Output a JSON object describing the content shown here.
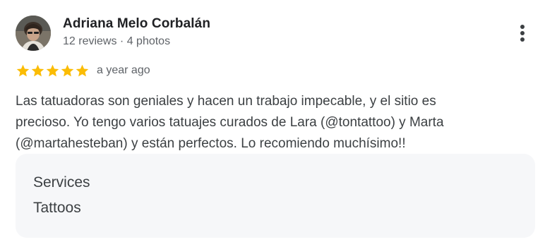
{
  "review": {
    "author": {
      "name": "Adriana Melo Corbalán",
      "meta": "12 reviews · 4 photos"
    },
    "rating": {
      "stars": 5,
      "max_stars": 5,
      "star_color": "#fbbc04"
    },
    "date": "a year ago",
    "text_lines": [
      "Las tatuadoras son geniales y hacen un trabajo impecable, y el sitio es",
      "precioso. Yo tengo varios tatuajes curados de Lara (@tontattoo) y Marta",
      "(@martahesteban) y están perfectos. Lo recomiendo muchísimo!!"
    ],
    "services": {
      "heading": "Services",
      "value": "Tattoos"
    },
    "more_icon": "more-vert-icon"
  }
}
